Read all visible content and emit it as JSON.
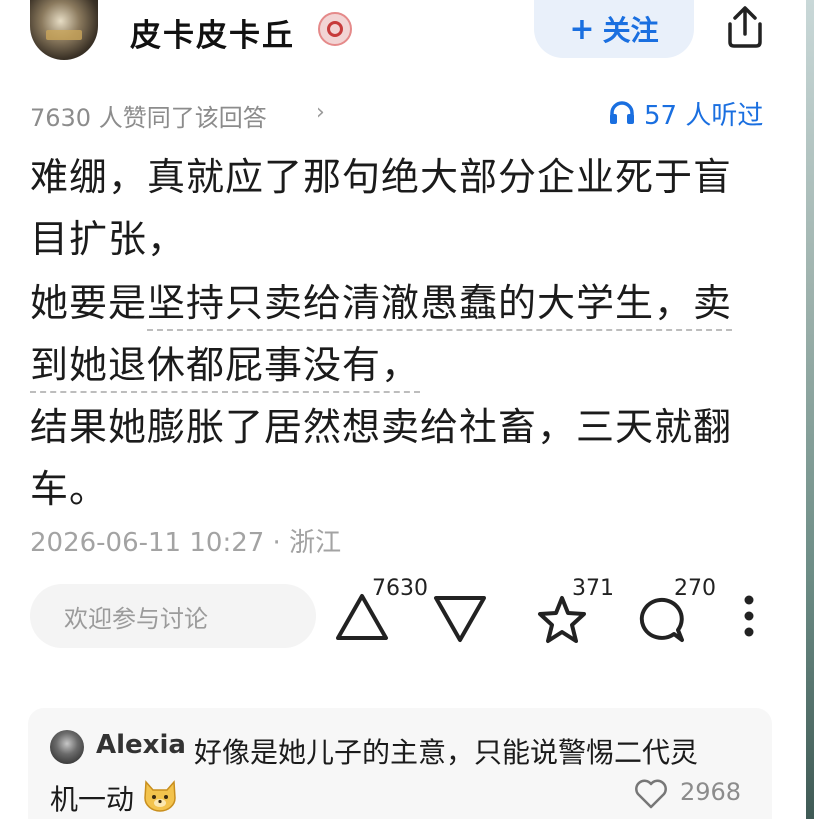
{
  "header": {
    "username": "皮卡皮卡丘",
    "follow_plus": "+",
    "follow_label": "关注"
  },
  "meta": {
    "likes_text": "7630 人赞同了该回答",
    "chevron": "›",
    "listen_text": "57 人听过"
  },
  "answer": {
    "p1": "难绷，真就应了那句绝大部分企业死于盲目扩张，",
    "p2a": "她要是",
    "p2b": "坚持只卖给清澈愚蠢的大学生，卖到她退休都屁事没有，",
    "p3": "结果她膨胀了居然想卖给社畜，三天就翻车。"
  },
  "timestamp": "2026-06-11 10:27 · 浙江",
  "actions": {
    "comment_placeholder": "欢迎参与讨论",
    "upvote_count": "7630",
    "star_count": "371",
    "comment_count": "270"
  },
  "reply": {
    "name": "Alexia",
    "text_line1": "好像是她儿子的主意，只能说警惕二代灵",
    "text_line2": "机一动",
    "like_count": "2968"
  },
  "colors": {
    "accent": "#1a6fe0",
    "text": "#1b1b1b",
    "muted": "#8c8c8c",
    "emoji": "#f3c34d"
  },
  "icons": [
    "share-icon",
    "headphones-icon",
    "upvote-icon",
    "downvote-icon",
    "star-icon",
    "comment-icon",
    "more-icon",
    "heart-icon",
    "dog-emoji-icon",
    "verified-badge-icon"
  ]
}
